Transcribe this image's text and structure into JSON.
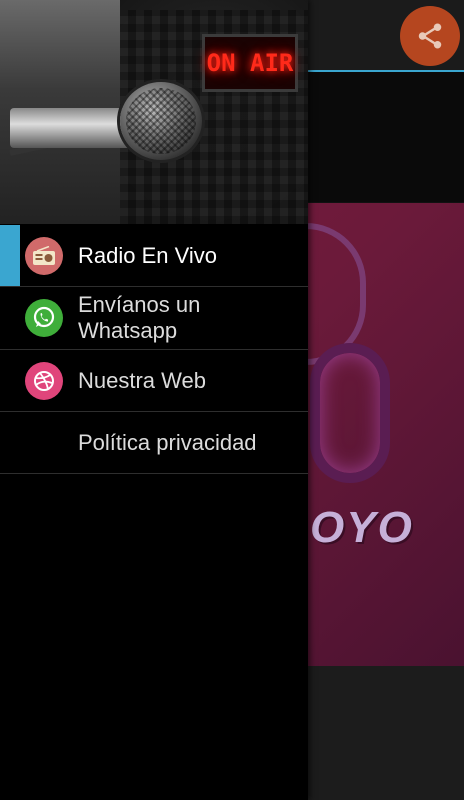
{
  "background": {
    "banner_text": "OYO",
    "share_icon": "share-icon"
  },
  "drawer": {
    "header": {
      "sign_text": "ON AIR"
    },
    "items": [
      {
        "label": "Radio En Vivo",
        "icon": "radio-icon",
        "icon_color": "#d06a6a",
        "active": true
      },
      {
        "label": "Envíanos un Whatsapp",
        "icon": "whatsapp-icon",
        "icon_color": "#3fae3a",
        "active": false
      },
      {
        "label": "Nuestra Web",
        "icon": "dribbble-icon",
        "icon_color": "#e0457b",
        "active": false
      },
      {
        "label": "Política privacidad",
        "icon": "",
        "icon_color": "",
        "active": false
      }
    ]
  },
  "colors": {
    "accent": "#3aa6d0",
    "share_button": "#b5461f"
  }
}
